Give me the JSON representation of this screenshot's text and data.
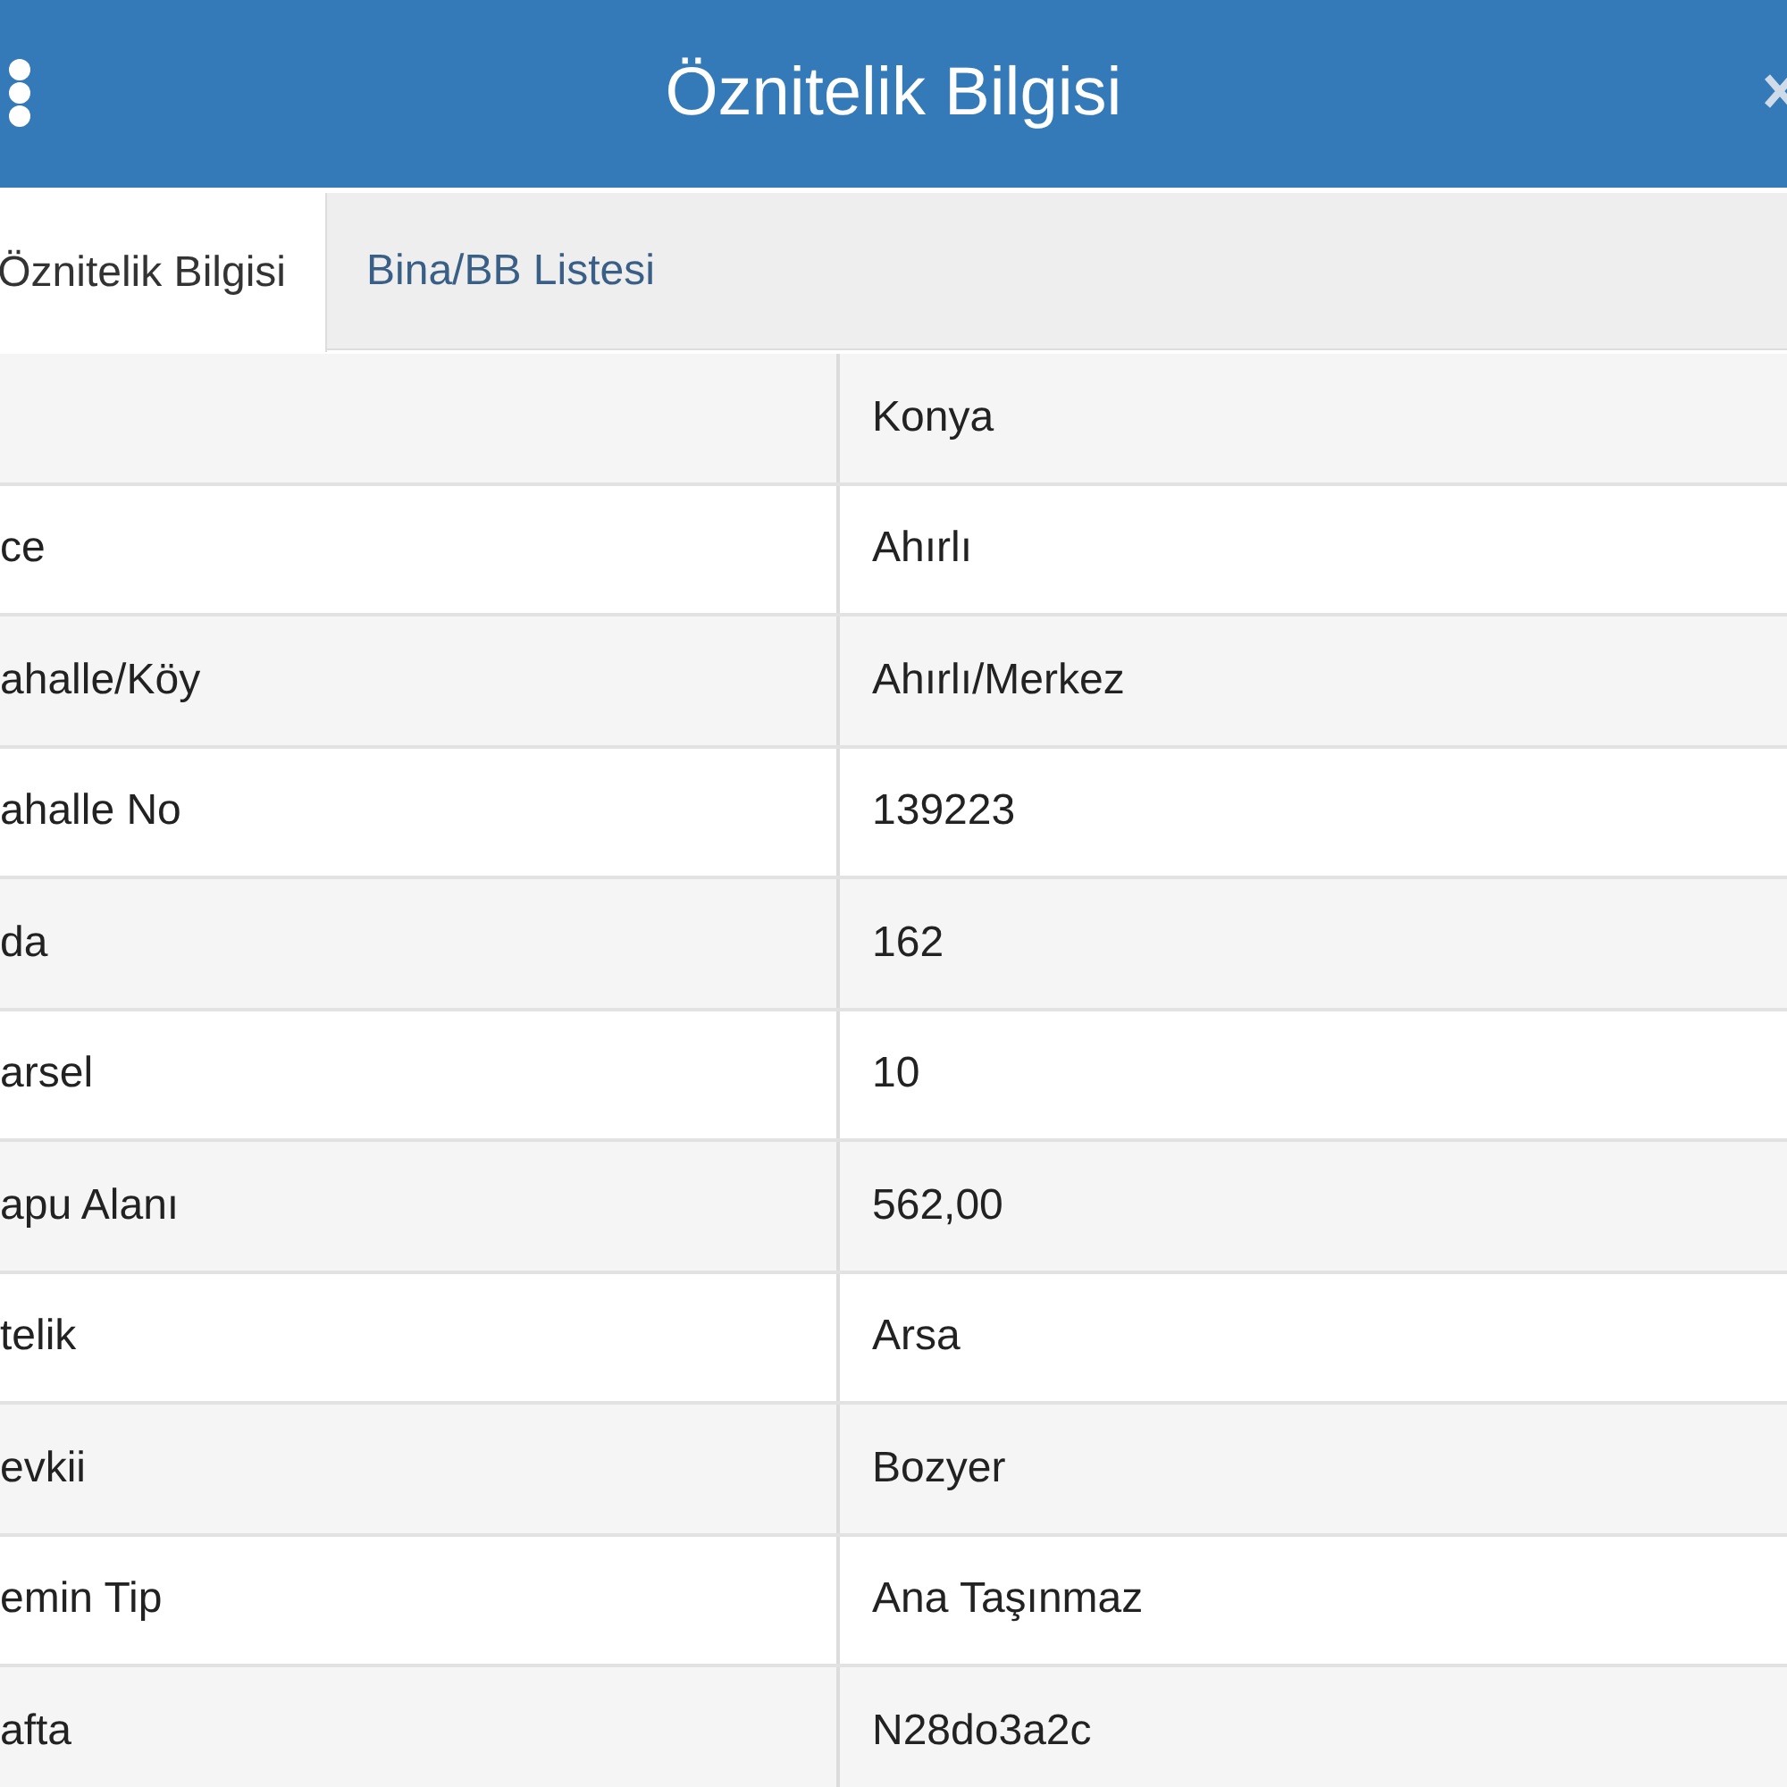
{
  "header": {
    "title": "Öznitelik Bilgisi"
  },
  "tabs": [
    {
      "label": "Öznitelik Bilgisi",
      "selected": true
    },
    {
      "label": "Bina/BB Listesi",
      "selected": false
    }
  ],
  "rows": [
    {
      "value": "Konya"
    },
    {
      "label": "ce",
      "value": "Ahırlı"
    },
    {
      "label": "ahalle/Köy",
      "value": "Ahırlı/Merkez"
    },
    {
      "label": "ahalle No",
      "value": "139223"
    },
    {
      "label": "da",
      "value": "162"
    },
    {
      "label": "arsel",
      "value": "10"
    },
    {
      "label": "apu Alanı",
      "value": "562,00"
    },
    {
      "label": "telik",
      "value": "Arsa"
    },
    {
      "label": "evkii",
      "value": "Bozyer"
    },
    {
      "label": "emin Tip",
      "value": "Ana Taşınmaz"
    },
    {
      "label": "afta",
      "value": "N28do3a2c"
    }
  ]
}
